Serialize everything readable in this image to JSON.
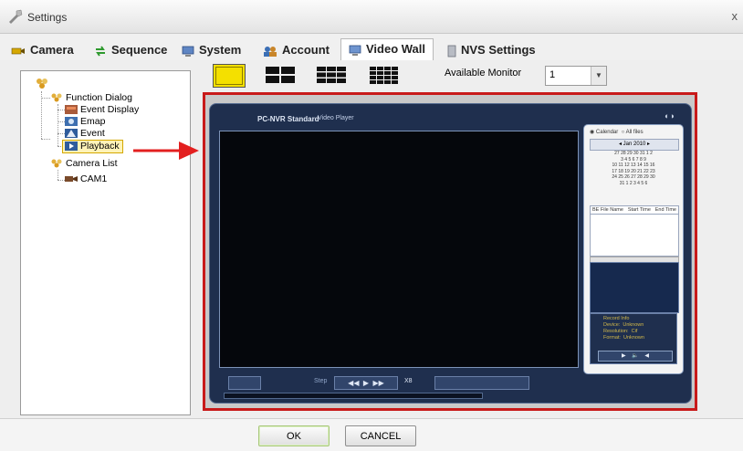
{
  "window": {
    "title": "Settings",
    "close_glyph": "x"
  },
  "tabs": [
    {
      "label": "Camera",
      "icon": "camera-icon"
    },
    {
      "label": "Sequence",
      "icon": "sequence-icon"
    },
    {
      "label": "System",
      "icon": "system-icon"
    },
    {
      "label": "Account",
      "icon": "account-icon"
    },
    {
      "label": "Video Wall",
      "icon": "video-wall-icon",
      "active": true
    },
    {
      "label": "NVS Settings",
      "icon": "nvs-icon"
    }
  ],
  "tree": {
    "items": [
      {
        "label": "Function Dialog",
        "icon": "folder-icon"
      },
      {
        "label": "Event Display",
        "icon": "event-display-icon"
      },
      {
        "label": "Emap",
        "icon": "emap-icon"
      },
      {
        "label": "Event",
        "icon": "event-icon"
      },
      {
        "label": "Playback",
        "icon": "playback-icon",
        "selected": true
      },
      {
        "label": "Camera List",
        "icon": "folder-icon"
      },
      {
        "label": "CAM1",
        "icon": "camera-icon"
      }
    ]
  },
  "layout_presets": [
    "1x1",
    "2x2",
    "3x3",
    "4x4"
  ],
  "monitor": {
    "label": "Available Monitor",
    "value": "1"
  },
  "player": {
    "title": "PC-NVR Standard",
    "subtitle": "Video Player",
    "calendar": {
      "option_a": "Calendar",
      "option_b": "All files",
      "month_label": "Jan 2010",
      "rows": [
        [
          "27",
          "28",
          "29",
          "30",
          "31",
          "1",
          "2"
        ],
        [
          "3",
          "4",
          "5",
          "6",
          "7",
          "8",
          "9"
        ],
        [
          "10",
          "11",
          "12",
          "13",
          "14",
          "15",
          "16"
        ],
        [
          "17",
          "18",
          "19",
          "20",
          "21",
          "22",
          "23"
        ],
        [
          "24",
          "25",
          "26",
          "27",
          "28",
          "29",
          "30"
        ],
        [
          "31",
          "1",
          "2",
          "3",
          "4",
          "5",
          "6"
        ]
      ]
    },
    "file_table": {
      "headers": [
        "BE File Name",
        "Start Time",
        "End Time"
      ]
    },
    "info": [
      [
        "Record Info",
        ""
      ],
      [
        "Device:",
        "Unknown"
      ],
      [
        "Resolution:",
        "Cif"
      ],
      [
        "Format:",
        "Unknown"
      ]
    ],
    "speed_label": "Step",
    "speed_value": "X8"
  },
  "buttons": {
    "ok": "OK",
    "cancel": "CANCEL"
  },
  "colors": {
    "highlight_border": "#c81a1a",
    "player_bg": "#1f2f4e",
    "arrow": "#e31f1f"
  }
}
